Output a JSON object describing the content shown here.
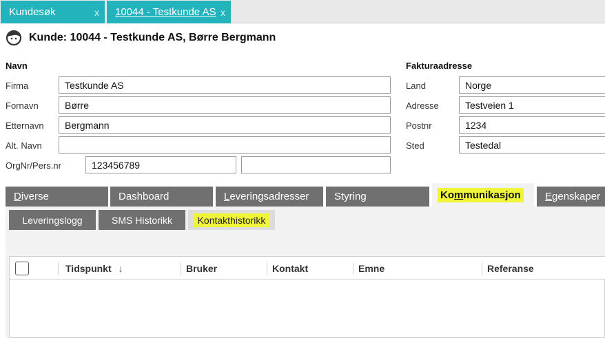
{
  "top_tabs": [
    {
      "label": "Kundesøk",
      "close": "x"
    },
    {
      "label": "10044 - Testkunde AS",
      "close": "x"
    }
  ],
  "header": {
    "title": "Kunde: 10044 - Testkunde AS, Børre Bergmann",
    "icon": "customer-face-icon"
  },
  "navn": {
    "heading": "Navn",
    "fields": [
      {
        "label": "Firma",
        "value": "Testkunde AS"
      },
      {
        "label": "Fornavn",
        "value": "Børre"
      },
      {
        "label": "Etternavn",
        "value": "Bergmann"
      },
      {
        "label": "Alt. Navn",
        "value": ""
      },
      {
        "label": "OrgNr/Pers.nr",
        "value": "123456789",
        "value2": ""
      }
    ]
  },
  "faktura": {
    "heading": "Fakturaadresse",
    "fields": [
      {
        "label": "Land",
        "value": "Norge"
      },
      {
        "label": "Adresse",
        "value": "Testveien 1"
      },
      {
        "label": "Postnr",
        "value": "1234"
      },
      {
        "label": "Sted",
        "value": "Testedal"
      }
    ]
  },
  "main_tabs": [
    {
      "first": "D",
      "rest": "iverse"
    },
    {
      "first": "",
      "rest": "Dashboard"
    },
    {
      "first": "L",
      "rest": "everingsadresser"
    },
    {
      "first": "",
      "rest": "Styring"
    },
    {
      "pre": "Ko",
      "u": "m",
      "post": "munikasjon"
    },
    {
      "first": "E",
      "rest": "genskaper"
    }
  ],
  "sub_tabs": [
    "Leveringslogg",
    "SMS Historikk",
    "Kontakthistorikk"
  ],
  "grid": {
    "columns": [
      "Tidspunkt",
      "Bruker",
      "Kontakt",
      "Emne",
      "Referanse"
    ],
    "sort_indicator": "↓",
    "rows": []
  },
  "colors": {
    "tab_accent": "#23b3bd",
    "highlight": "#f0f53a",
    "tab_grey": "#707070"
  }
}
